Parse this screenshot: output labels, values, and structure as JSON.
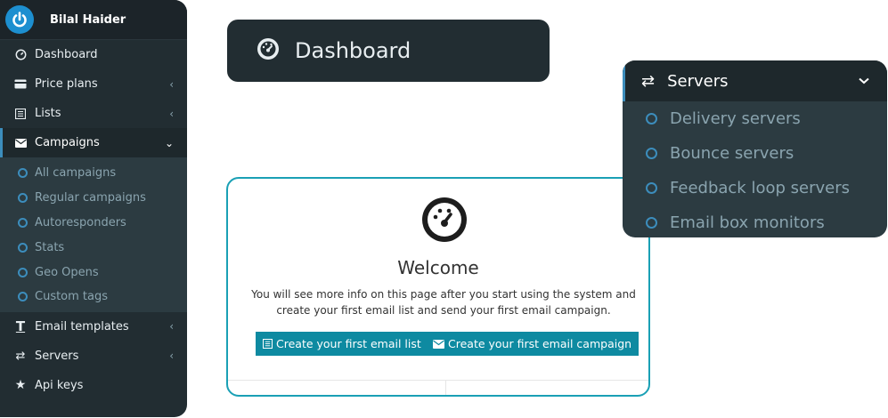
{
  "sidebar": {
    "user_name": "Bilal Haider",
    "menu": [
      {
        "label": "Dashboard",
        "icon": "dashboard-icon"
      },
      {
        "label": "Price plans",
        "icon": "credit-card-icon"
      },
      {
        "label": "Lists",
        "icon": "list-icon"
      },
      {
        "label": "Campaigns",
        "icon": "envelope-icon"
      },
      {
        "label": "Email templates",
        "icon": "text-height-icon"
      },
      {
        "label": "Servers",
        "icon": "exchange-icon"
      },
      {
        "label": "Api keys",
        "icon": "star-icon"
      }
    ],
    "campaigns_submenu": [
      "All campaigns",
      "Regular campaigns",
      "Autoresponders",
      "Stats",
      "Geo Opens",
      "Custom tags"
    ]
  },
  "dashboard_card": {
    "title": "Dashboard"
  },
  "welcome": {
    "title": "Welcome",
    "text_line1": "You will see more info on this page after you start using the system and",
    "text_line2": "create your first email list and send your first email campaign.",
    "button_list": "Create your first email list",
    "button_campaign": "Create your first email campaign"
  },
  "servers_card": {
    "title": "Servers",
    "items": [
      "Delivery servers",
      "Bounce servers",
      "Feedback loop servers",
      "Email box monitors"
    ]
  },
  "colors": {
    "sidebar_bg": "#222d32",
    "accent": "#3c8dbc",
    "button": "#0e8aa1",
    "card_border": "#1aa0b5"
  }
}
